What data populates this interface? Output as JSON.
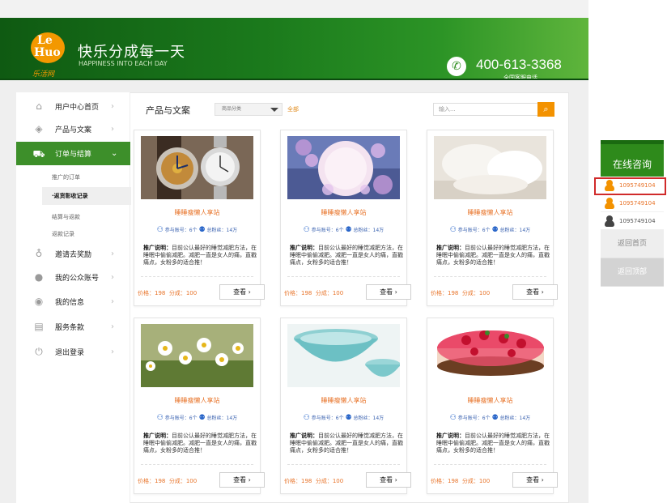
{
  "header": {
    "logo_le": "Le",
    "logo_huo": "Huo",
    "logo_sub": "乐活网",
    "slogan": "快乐分成每一天",
    "slogan_en": "HAPPINESS INTO EACH DAY",
    "phone": "400-613-3368",
    "phone_sub": "全国客服电话"
  },
  "sidebar": {
    "items": [
      {
        "label": "用户中心首页",
        "icon": "home-icon"
      },
      {
        "label": "产品与文案",
        "icon": "layers-icon"
      },
      {
        "label": "订单与结算",
        "icon": "cart-icon"
      },
      {
        "label": "邀请去奖励",
        "icon": "gift-icon"
      },
      {
        "label": "我的公众账号",
        "icon": "user-icon"
      },
      {
        "label": "我的信息",
        "icon": "message-icon"
      },
      {
        "label": "服务条款",
        "icon": "document-icon"
      },
      {
        "label": "退出登录",
        "icon": "power-icon"
      }
    ],
    "subitems": [
      "推广的订单",
      "·返货彰收记录",
      "结算与返款",
      "返款记录"
    ]
  },
  "main": {
    "title": "产品与文案",
    "category_select": "商品分类",
    "category_all": "全部",
    "search_placeholder": "输入..."
  },
  "products": [
    {
      "title": "睡睡瘦懒人享站",
      "participants": "参与账号：6个",
      "followers": "总粉丝：14万",
      "desc_label": "推广说明：",
      "desc": "目前公认最好的睡觉减肥方法，在睡眠中偷偷减肥。减肥一直是女人的痛，直戳痛点，女粉多的适合推！",
      "price": "价格：198",
      "share": "分成：100",
      "button": "查看"
    },
    {
      "title": "睡睡瘦懒人享站",
      "participants": "参与账号：6个",
      "followers": "总粉丝：14万",
      "desc_label": "推广说明：",
      "desc": "目前公认最好的睡觉减肥方法，在睡眠中偷偷减肥。减肥一直是女人的痛，直戳痛点，女粉多的适合推！",
      "price": "价格：198",
      "share": "分成：100",
      "button": "查看"
    },
    {
      "title": "睡睡瘦懒人享站",
      "participants": "参与账号：6个",
      "followers": "总粉丝：14万",
      "desc_label": "推广说明：",
      "desc": "目前公认最好的睡觉减肥方法，在睡眠中偷偷减肥。减肥一直是女人的痛，直戳痛点，女粉多的适合推！",
      "price": "价格：198",
      "share": "分成：100",
      "button": "查看"
    },
    {
      "title": "睡睡瘦懒人享站",
      "participants": "参与账号：6个",
      "followers": "总粉丝：14万",
      "desc_label": "推广说明：",
      "desc": "目前公认最好的睡觉减肥方法，在睡眠中偷偷减肥。减肥一直是女人的痛，直戳痛点，女粉多的适合推！",
      "price": "价格：198",
      "share": "分成：100",
      "button": "查看"
    },
    {
      "title": "睡睡瘦懒人享站",
      "participants": "参与账号：6个",
      "followers": "总粉丝：14万",
      "desc_label": "推广说明：",
      "desc": "目前公认最好的睡觉减肥方法，在睡眠中偷偷减肥。减肥一直是女人的痛，直戳痛点，女粉多的适合推！",
      "price": "价格：198",
      "share": "分成：100",
      "button": "查看"
    },
    {
      "title": "睡睡瘦懒人享站",
      "participants": "参与账号：6个",
      "followers": "总粉丝：14万",
      "desc_label": "推广说明：",
      "desc": "目前公认最好的睡觉减肥方法，在睡眠中偷偷减肥。减肥一直是女人的痛，直戳痛点，女粉多的适合推！",
      "price": "价格：198",
      "share": "分成：100",
      "button": "查看"
    }
  ],
  "consult": {
    "title": "在线咨询",
    "qq": [
      "1095749104",
      "1095749104",
      "1095749104"
    ],
    "back_home": "返回首页",
    "back_top": "返回顶部"
  }
}
